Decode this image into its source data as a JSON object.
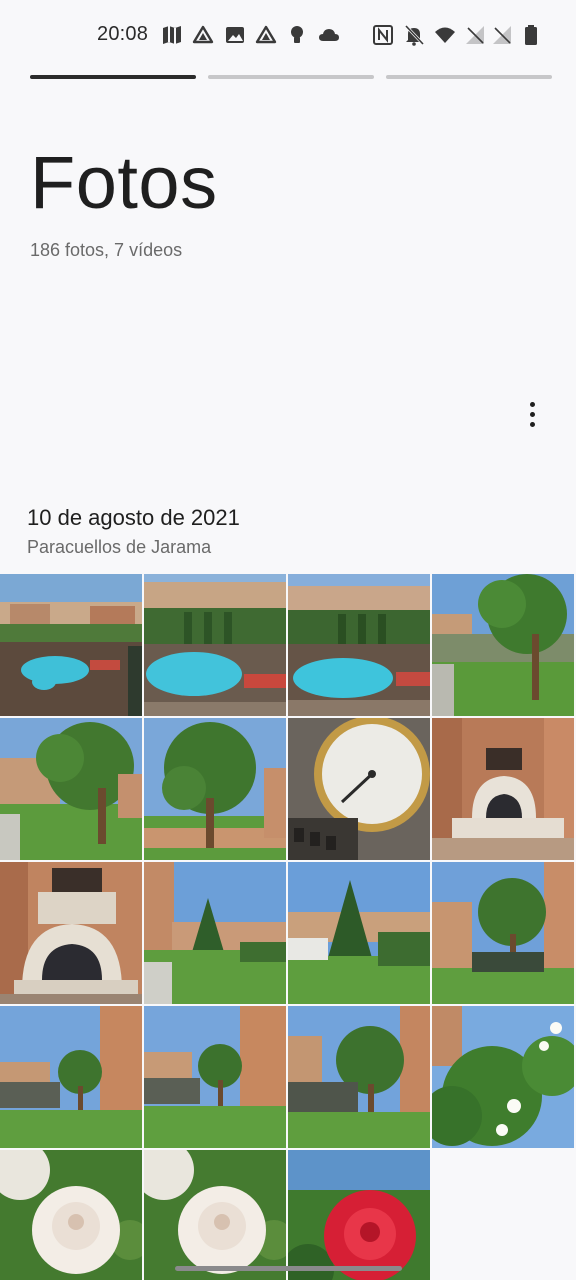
{
  "status_bar": {
    "time": "20:08",
    "left_icons": [
      "maps-icon",
      "drive-icon",
      "image-icon",
      "drive-icon",
      "bulb-icon",
      "cloud-icon"
    ],
    "right_icons": [
      "nfc-icon",
      "bell-off-icon",
      "wifi-icon",
      "no-signal-icon",
      "no-signal-icon",
      "battery-icon"
    ]
  },
  "story": {
    "segments": 3,
    "active_segment": 1
  },
  "header": {
    "title": "Fotos",
    "subtitle": "186 fotos, 7 vídeos"
  },
  "section": {
    "date": "10 de agosto de 2021",
    "location": "Paracuellos de Jarama"
  },
  "photos": [
    "pool-photo",
    "pool-photo",
    "pool-photo",
    "garden-tree-photo",
    "garden-tree-photo",
    "garden-tree-photo",
    "thermometer-gauge-photo",
    "brick-oven-photo",
    "brick-oven-photo",
    "garden-fir-photo",
    "garden-fir-photo",
    "garden-tree-photo",
    "garden-tree-photo",
    "garden-tree-photo",
    "garden-tree-photo",
    "rose-bush-photo",
    "white-rose-photo",
    "white-rose-photo",
    "red-rose-photo"
  ],
  "colors": {
    "background": "#f8f8fa",
    "text_primary": "#1f1f1f",
    "text_secondary": "#6a6a6a",
    "progress_active": "#2b2b2b",
    "progress_inactive": "#c7c7c9"
  }
}
